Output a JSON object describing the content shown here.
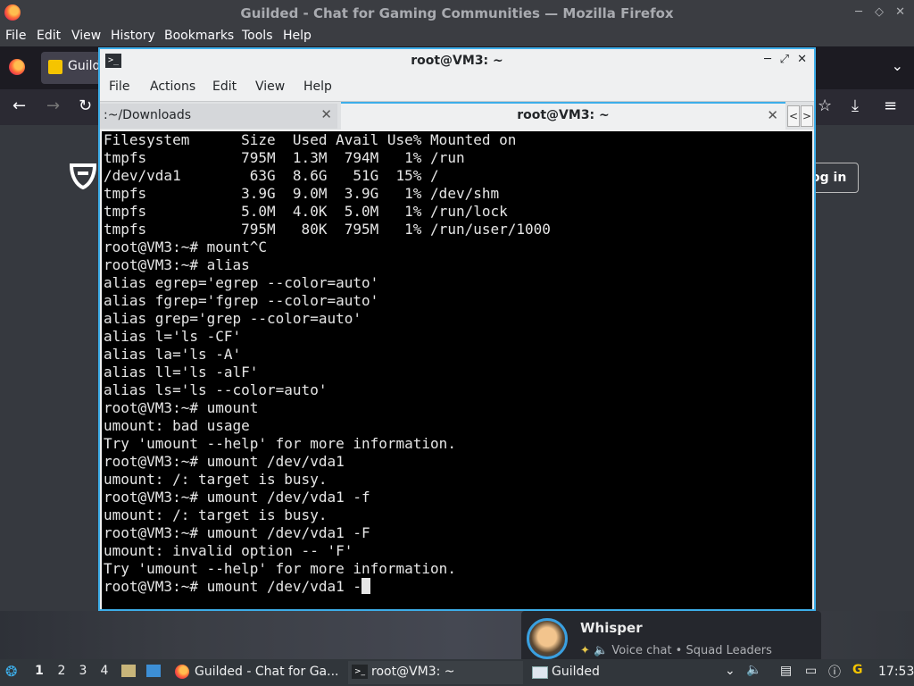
{
  "firefox": {
    "title": "Guilded - Chat for Gaming Communities — Mozilla Firefox",
    "menu": [
      "File",
      "Edit",
      "View",
      "History",
      "Bookmarks",
      "Tools",
      "Help"
    ],
    "tab_label": "Guild",
    "login_label": "og in"
  },
  "terminal": {
    "title": "root@VM3: ~",
    "menu": [
      "File",
      "Actions",
      "Edit",
      "View",
      "Help"
    ],
    "tabs": [
      {
        "label": ":~/Downloads"
      },
      {
        "label": "root@VM3: ~"
      }
    ],
    "output": "Filesystem      Size  Used Avail Use% Mounted on\ntmpfs           795M  1.3M  794M   1% /run\n/dev/vda1        63G  8.6G   51G  15% /\ntmpfs           3.9G  9.0M  3.9G   1% /dev/shm\ntmpfs           5.0M  4.0K  5.0M   1% /run/lock\ntmpfs           795M   80K  795M   1% /run/user/1000\nroot@VM3:~# mount^C\nroot@VM3:~# alias\nalias egrep='egrep --color=auto'\nalias fgrep='fgrep --color=auto'\nalias grep='grep --color=auto'\nalias l='ls -CF'\nalias la='ls -A'\nalias ll='ls -alF'\nalias ls='ls --color=auto'\nroot@VM3:~# umount\numount: bad usage\nTry 'umount --help' for more information.\nroot@VM3:~# umount /dev/vda1\numount: /: target is busy.\nroot@VM3:~# umount /dev/vda1 -f\numount: /: target is busy.\nroot@VM3:~# umount /dev/vda1 -F\numount: invalid option -- 'F'\nTry 'umount --help' for more information.\nroot@VM3:~# umount /dev/vda1 -"
  },
  "notification": {
    "name": "Whisper",
    "subtitle": "Voice chat • Squad Leaders"
  },
  "taskbar": {
    "desktops": [
      "1",
      "2",
      "3",
      "4"
    ],
    "tasks": [
      {
        "label": "Guilded - Chat for Ga..."
      },
      {
        "label": "root@VM3: ~"
      },
      {
        "label": "Guilded"
      }
    ],
    "clock": "17:53"
  },
  "colors": {
    "accent": "#3daee9",
    "terminal_bg": "#000000",
    "terminal_fg": "#e6e6e6",
    "guilded_yellow": "#f5c400"
  }
}
